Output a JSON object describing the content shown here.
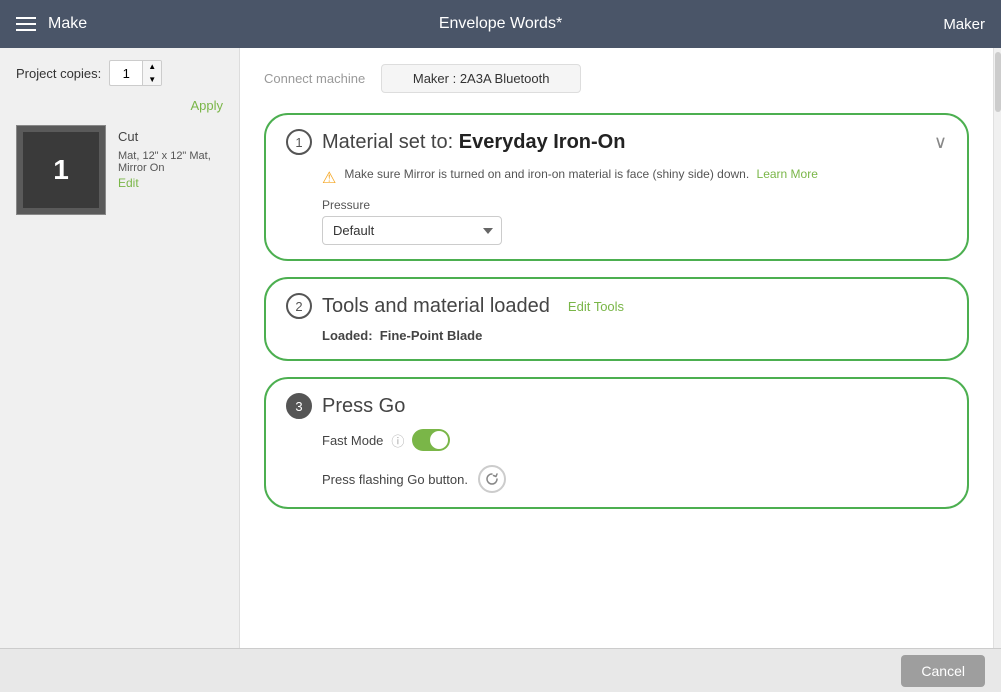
{
  "header": {
    "make_label": "Make",
    "title": "Envelope Words*",
    "maker_label": "Maker"
  },
  "sidebar": {
    "project_copies_label": "Project copies:",
    "copies_value": "1",
    "apply_label": "Apply",
    "mat_number": "1",
    "cut_label": "Cut",
    "mat_info": "Mat, 12\" x 12\" Mat, Mirror On",
    "edit_label": "Edit"
  },
  "content": {
    "connect_machine_label": "Connect machine",
    "machine_btn_label": "Maker : 2A3A Bluetooth",
    "step1": {
      "number": "1",
      "title_prefix": "Material set to:",
      "title_bold": "Everyday Iron-On",
      "warning_text": "Make sure Mirror is turned on and iron-on material is face (shiny side) down.",
      "learn_more_label": "Learn More",
      "pressure_label": "Pressure",
      "pressure_default": "Default"
    },
    "step2": {
      "number": "2",
      "title": "Tools and material loaded",
      "edit_tools_label": "Edit Tools",
      "loaded_label": "Loaded:",
      "loaded_value": "Fine-Point Blade"
    },
    "step3": {
      "number": "3",
      "title": "Press Go",
      "fast_mode_label": "Fast Mode",
      "press_go_text": "Press flashing Go button."
    },
    "footer": {
      "cancel_label": "Cancel"
    }
  }
}
